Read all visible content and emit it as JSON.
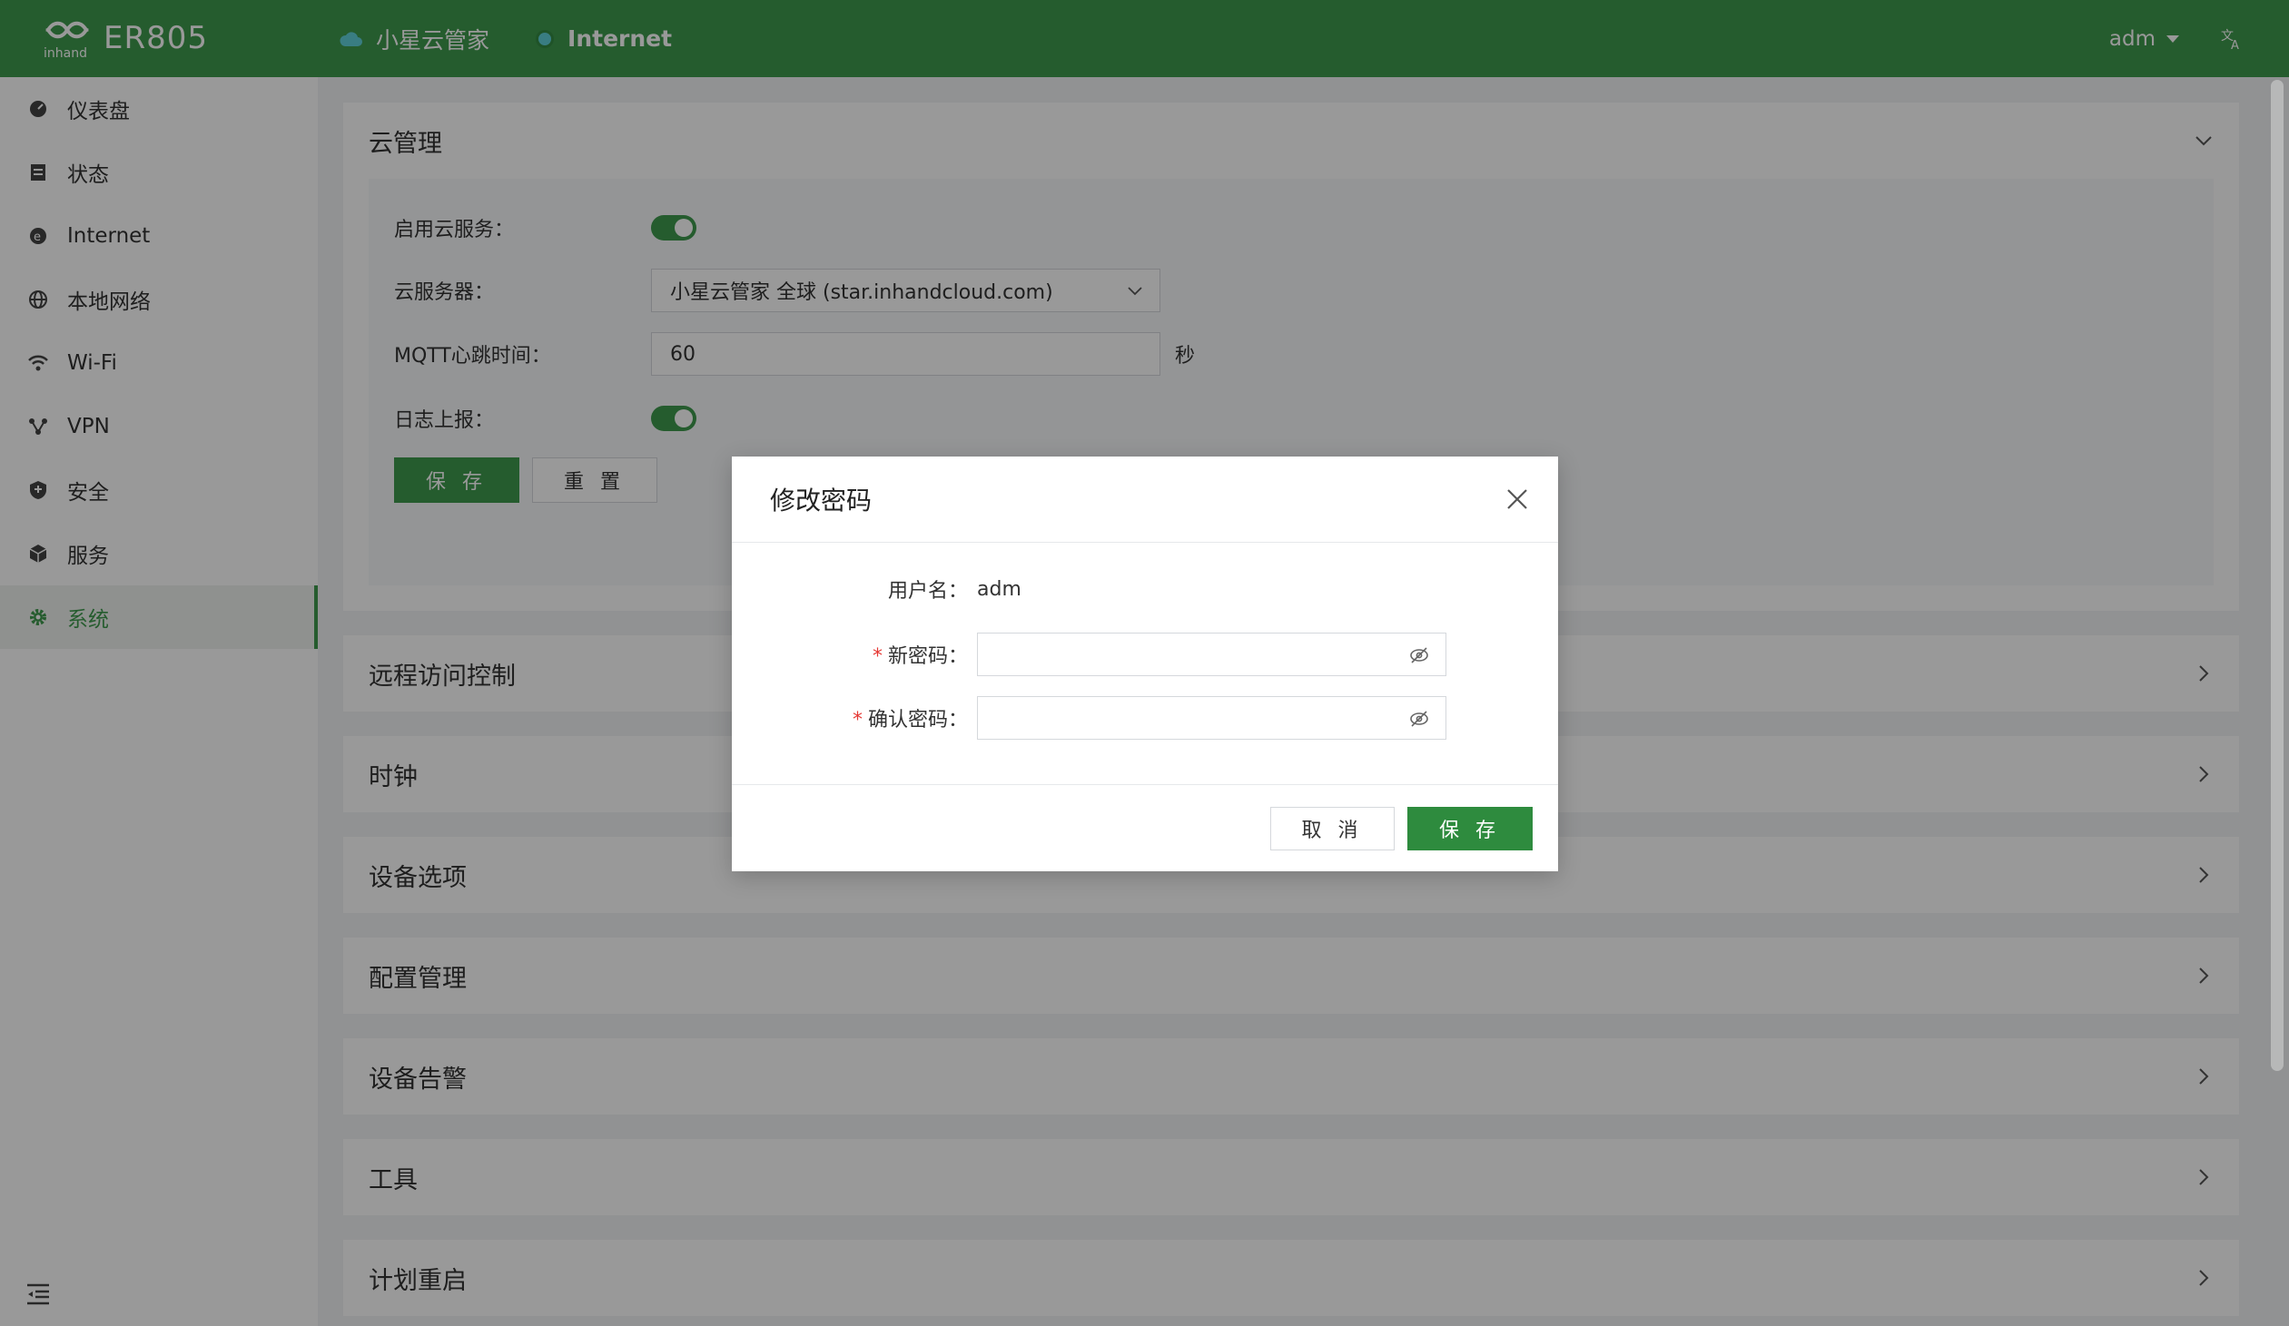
{
  "header": {
    "brand_model": "ER805",
    "cloud_status": "小星云管家",
    "internet_status": "Internet",
    "user": "adm"
  },
  "sidebar": {
    "items": [
      {
        "label": "仪表盘",
        "icon": "dashboard-icon"
      },
      {
        "label": "状态",
        "icon": "status-icon"
      },
      {
        "label": "Internet",
        "icon": "internet-icon"
      },
      {
        "label": "本地网络",
        "icon": "globe-icon"
      },
      {
        "label": "Wi-Fi",
        "icon": "wifi-icon"
      },
      {
        "label": "VPN",
        "icon": "vpn-icon"
      },
      {
        "label": "安全",
        "icon": "shield-icon"
      },
      {
        "label": "服务",
        "icon": "cube-icon"
      },
      {
        "label": "系统",
        "icon": "gear-icon"
      }
    ],
    "active_index": 8
  },
  "cloud": {
    "title": "云管理",
    "enable_label": "启用云服务：",
    "enable_value": true,
    "server_label": "云服务器：",
    "server_value": "小星云管家 全球 (star.inhandcloud.com)",
    "mqtt_label": "MQTT心跳时间：",
    "mqtt_value": "60",
    "mqtt_unit": "秒",
    "log_label": "日志上报：",
    "log_value": true,
    "save_label": "保 存",
    "reset_label": "重 置"
  },
  "sections": [
    "远程访问控制",
    "时钟",
    "设备选项",
    "配置管理",
    "设备告警",
    "工具",
    "计划重启"
  ],
  "modal": {
    "title": "修改密码",
    "username_label": "用户名：",
    "username_value": "adm",
    "new_password_label": "新密码：",
    "confirm_password_label": "确认密码：",
    "required_mark": "*",
    "cancel_label": "取 消",
    "save_label": "保 存"
  },
  "colors": {
    "brand_green": "#3f9a4e",
    "primary_button": "#2e8b3e",
    "required_red": "#e53935"
  }
}
